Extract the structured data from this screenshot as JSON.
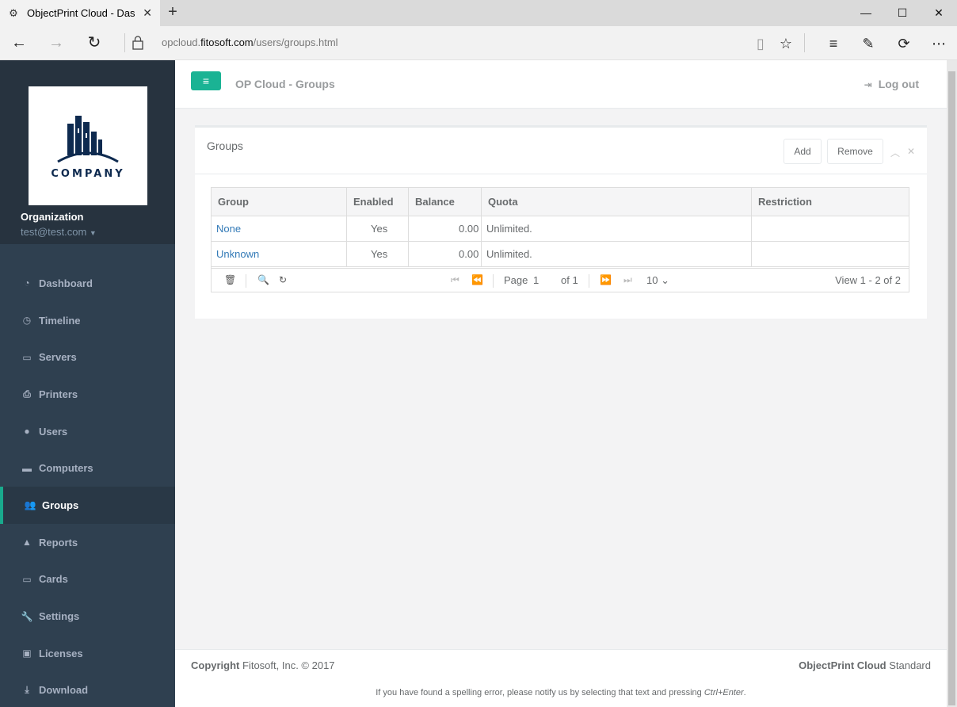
{
  "browser": {
    "tab_title": "ObjectPrint Cloud - Das",
    "url_prefix": "opcloud.",
    "url_domain": "fitosoft.com",
    "url_path": "/users/groups.html"
  },
  "sidebar": {
    "logo_text": "COMPANY",
    "org_name": "Organization",
    "org_email": "test@test.com",
    "items": [
      {
        "label": "Dashboard",
        "icon": "dashboard-icon"
      },
      {
        "label": "Timeline",
        "icon": "clock-icon"
      },
      {
        "label": "Servers",
        "icon": "server-icon"
      },
      {
        "label": "Printers",
        "icon": "printer-icon"
      },
      {
        "label": "Users",
        "icon": "user-icon"
      },
      {
        "label": "Computers",
        "icon": "laptop-icon"
      },
      {
        "label": "Groups",
        "icon": "users-icon",
        "active": true
      },
      {
        "label": "Reports",
        "icon": "chart-icon"
      },
      {
        "label": "Cards",
        "icon": "card-icon"
      },
      {
        "label": "Settings",
        "icon": "wrench-icon"
      },
      {
        "label": "Licenses",
        "icon": "money-icon"
      },
      {
        "label": "Download",
        "icon": "download-icon"
      }
    ]
  },
  "topbar": {
    "title": "OP Cloud - Groups",
    "logout": "Log out"
  },
  "panel": {
    "title": "Groups",
    "add_label": "Add",
    "remove_label": "Remove"
  },
  "grid": {
    "columns": [
      "Group",
      "Enabled",
      "Balance",
      "Quota",
      "Restriction"
    ],
    "rows": [
      {
        "group": "None",
        "enabled": "Yes",
        "balance": "0.00",
        "quota": "Unlimited.",
        "restriction": ""
      },
      {
        "group": "Unknown",
        "enabled": "Yes",
        "balance": "0.00",
        "quota": "Unlimited.",
        "restriction": ""
      }
    ],
    "pager": {
      "page_label": "Page",
      "page_value": "1",
      "of_label": "of 1",
      "rows_per_page": "10",
      "view_text": "View 1 - 2 of 2"
    }
  },
  "footer": {
    "copyright_bold": "Copyright",
    "copyright_rest": "Fitosoft, Inc. © 2017",
    "product_bold": "ObjectPrint Cloud",
    "product_rest": "Standard",
    "notice_text": "If you have found a spelling error, please notify us by selecting that text and pressing",
    "notice_keys": "Ctrl+Enter"
  },
  "colors": {
    "sidebar_bg": "#2f4050",
    "accent": "#1ab394",
    "link": "#337ab7"
  }
}
